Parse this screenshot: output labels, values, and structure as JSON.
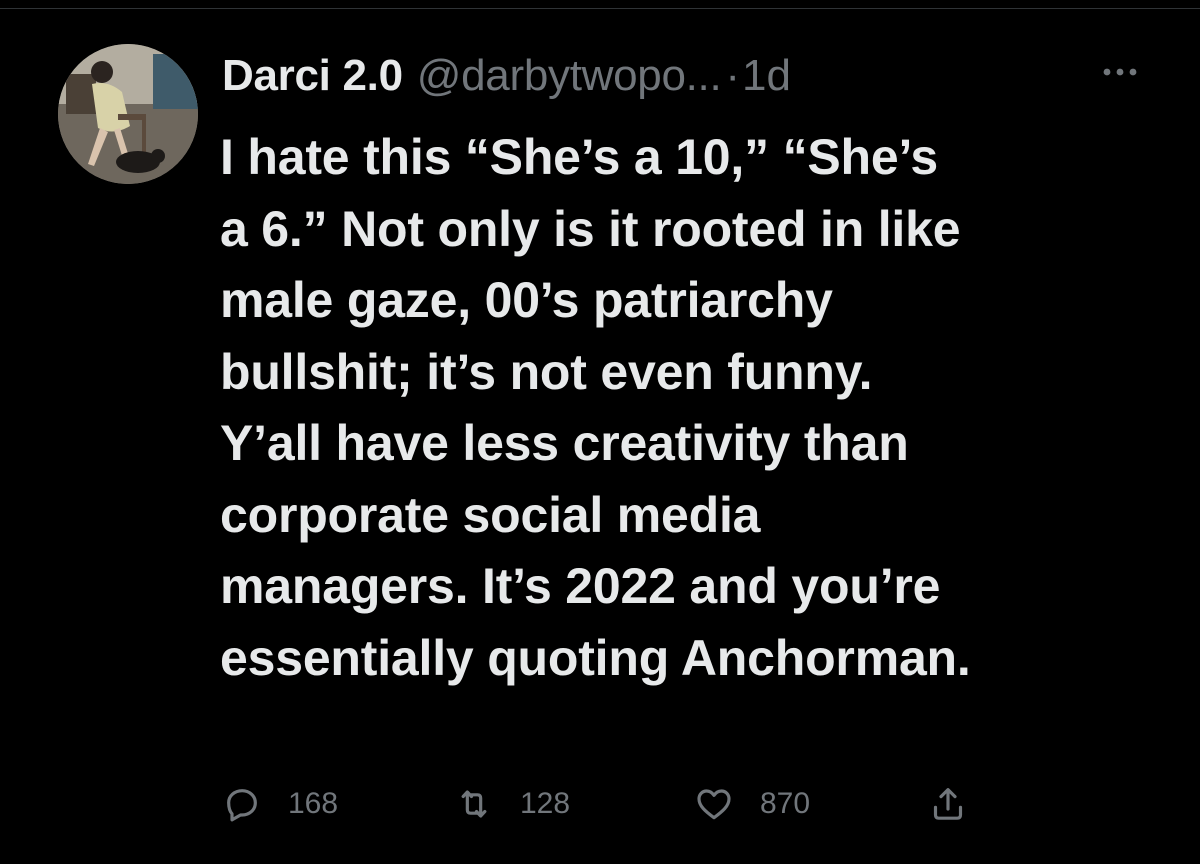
{
  "tweet": {
    "author": {
      "display_name": "Darci 2.0",
      "handle": "@darbytwopo...",
      "avatar_icon": "profile-photo"
    },
    "separator": "·",
    "timestamp": "1d",
    "more_icon": "more-horizontal-icon",
    "text_lines": [
      "I hate this “She’s a 10,” “She’s",
      "a 6.” Not only is it rooted in like",
      "male gaze, 00’s patriarchy",
      "bullshit; it’s not even funny.",
      "Y’all have less creativity than",
      "corporate social media",
      "managers. It’s 2022 and you’re",
      "essentially quoting Anchorman."
    ],
    "actions": {
      "reply": {
        "icon": "reply-icon",
        "count": "168"
      },
      "retweet": {
        "icon": "retweet-icon",
        "count": "128"
      },
      "like": {
        "icon": "heart-icon",
        "count": "870"
      },
      "share": {
        "icon": "share-icon"
      }
    }
  },
  "colors": {
    "background": "#000000",
    "primary_text": "#e7e9ea",
    "secondary_text": "#71767b",
    "divider": "#2f3336"
  }
}
